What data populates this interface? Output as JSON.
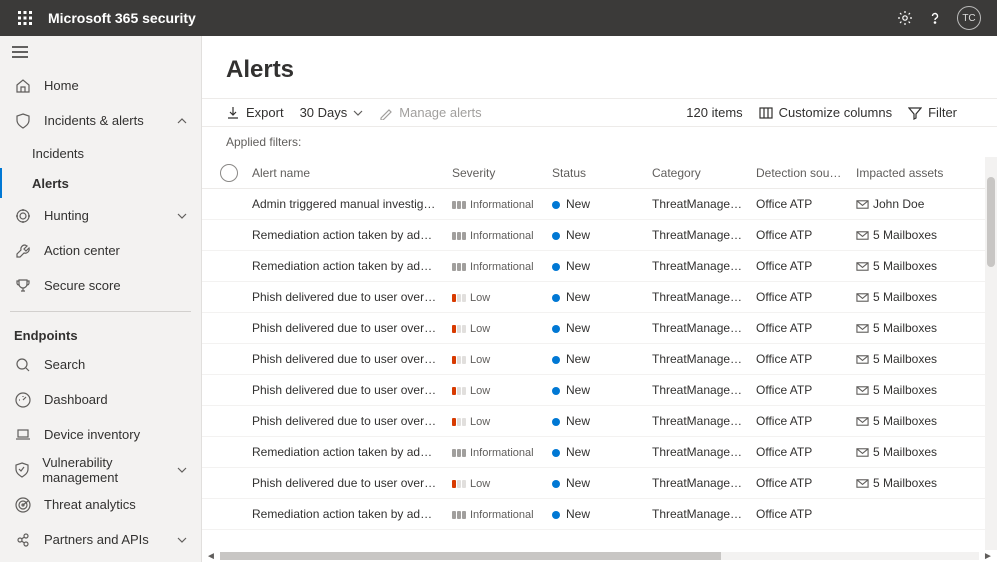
{
  "app_title": "Microsoft 365 security",
  "avatar_initials": "TC",
  "sidebar": {
    "items": [
      {
        "icon": "home",
        "label": "Home"
      },
      {
        "icon": "shield",
        "label": "Incidents & alerts",
        "chev": "up"
      },
      {
        "sub": true,
        "label": "Incidents"
      },
      {
        "sub": true,
        "label": "Alerts",
        "active": true
      },
      {
        "icon": "target",
        "label": "Hunting",
        "chev": "down"
      },
      {
        "icon": "wrench",
        "label": "Action center"
      },
      {
        "icon": "trophy",
        "label": "Secure score"
      }
    ],
    "endpoints_heading": "Endpoints",
    "endpoint_items": [
      {
        "icon": "search",
        "label": "Search"
      },
      {
        "icon": "gauge",
        "label": "Dashboard"
      },
      {
        "icon": "laptop",
        "label": "Device inventory"
      },
      {
        "icon": "shieldcheck",
        "label": "Vulnerability management",
        "chev": "down"
      },
      {
        "icon": "radar",
        "label": "Threat analytics"
      },
      {
        "icon": "link",
        "label": "Partners and APIs",
        "chev": "down"
      }
    ]
  },
  "page_title": "Alerts",
  "toolbar": {
    "export": "Export",
    "range": "30 Days",
    "manage": "Manage alerts",
    "items_count": "120 items",
    "customize": "Customize columns",
    "filter": "Filter"
  },
  "applied_filters_label": "Applied filters:",
  "columns": {
    "name": "Alert name",
    "severity": "Severity",
    "status": "Status",
    "category": "Category",
    "source": "Detection source",
    "assets": "Impacted assets"
  },
  "rows": [
    {
      "name": "Admin triggered manual investigation o...",
      "sev": "Informational",
      "sev_lvl": "info",
      "status": "New",
      "cat": "ThreatManagement",
      "src": "Office ATP",
      "asset": "John Doe"
    },
    {
      "name": "Remediation action taken by admin on ...",
      "sev": "Informational",
      "sev_lvl": "info",
      "status": "New",
      "cat": "ThreatManagement",
      "src": "Office ATP",
      "asset": "5 Mailboxes"
    },
    {
      "name": "Remediation action taken by admin on ...",
      "sev": "Informational",
      "sev_lvl": "info",
      "status": "New",
      "cat": "ThreatManagement",
      "src": "Office ATP",
      "asset": "5 Mailboxes"
    },
    {
      "name": "Phish delivered due to user override",
      "sev": "Low",
      "sev_lvl": "low",
      "status": "New",
      "cat": "ThreatManagement",
      "src": "Office ATP",
      "asset": "5 Mailboxes"
    },
    {
      "name": "Phish delivered due to user override",
      "sev": "Low",
      "sev_lvl": "low",
      "status": "New",
      "cat": "ThreatManagement",
      "src": "Office ATP",
      "asset": "5 Mailboxes"
    },
    {
      "name": "Phish delivered due to user override",
      "sev": "Low",
      "sev_lvl": "low",
      "status": "New",
      "cat": "ThreatManagement",
      "src": "Office ATP",
      "asset": "5 Mailboxes"
    },
    {
      "name": "Phish delivered due to user override",
      "sev": "Low",
      "sev_lvl": "low",
      "status": "New",
      "cat": "ThreatManagement",
      "src": "Office ATP",
      "asset": "5 Mailboxes"
    },
    {
      "name": "Phish delivered due to user override",
      "sev": "Low",
      "sev_lvl": "low",
      "status": "New",
      "cat": "ThreatManagement",
      "src": "Office ATP",
      "asset": "5 Mailboxes"
    },
    {
      "name": "Remediation action taken by admin on ...",
      "sev": "Informational",
      "sev_lvl": "info",
      "status": "New",
      "cat": "ThreatManagement",
      "src": "Office ATP",
      "asset": "5 Mailboxes"
    },
    {
      "name": "Phish delivered due to user override",
      "sev": "Low",
      "sev_lvl": "low",
      "status": "New",
      "cat": "ThreatManagement",
      "src": "Office ATP",
      "asset": "5 Mailboxes"
    },
    {
      "name": "Remediation action taken by admin on ...",
      "sev": "Informational",
      "sev_lvl": "info",
      "status": "New",
      "cat": "ThreatManagement",
      "src": "Office ATP",
      "asset": ""
    }
  ]
}
